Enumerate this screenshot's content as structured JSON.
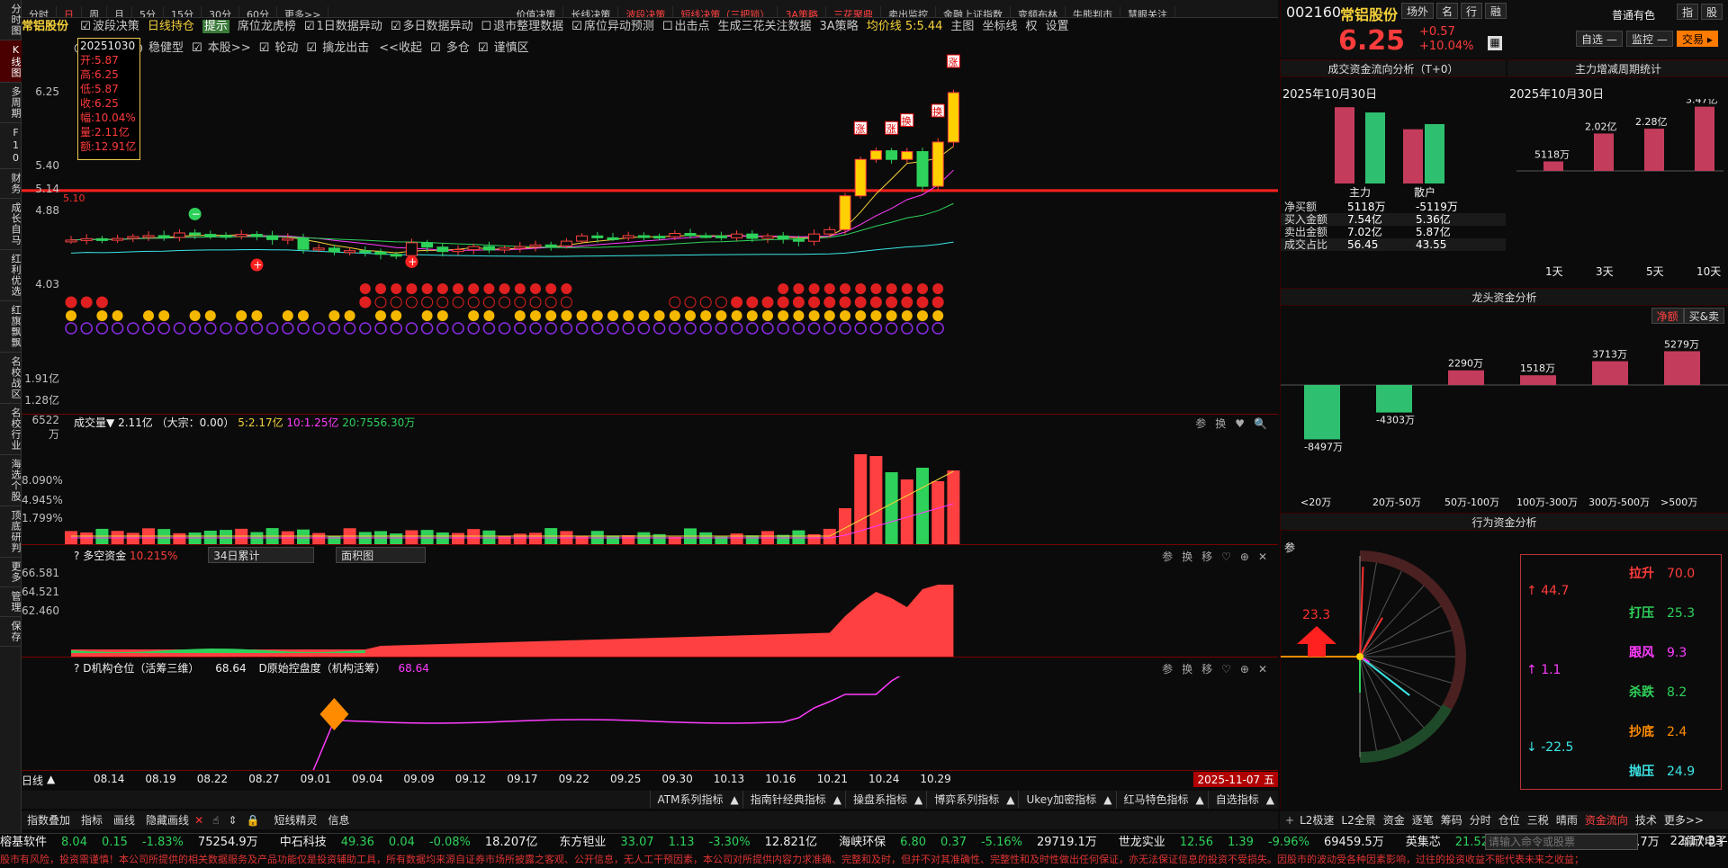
{
  "left_nav": [
    "分时图",
    "K线图",
    "多周期",
    "F10",
    "财务",
    "成长自马",
    "红利优选",
    "红旗飘飘",
    "名校战区",
    "名校行业",
    "海选个股",
    "顶底研判",
    "更多",
    "管理",
    "保存"
  ],
  "top_tabs": [
    "分时",
    "日",
    "周",
    "月",
    "5分",
    "15分",
    "30分",
    "60分",
    "更多>>"
  ],
  "strategy_tabs": [
    "价值决策",
    "长线决策",
    "波段决策",
    "短线决策（三把锁）",
    "3A策略",
    "三花聚鼎",
    "卖出监控",
    "金融上证指数",
    "变频布林",
    "牛熊判市",
    "慧眼关注"
  ],
  "chart": {
    "stock_name": "常铝股份",
    "bar1": [
      "波段决策",
      "日线持仓",
      "提示",
      "席位龙虎榜",
      "1日数据异动",
      "多日数据异动",
      "退市整理数据",
      "席位异动预测",
      "出击点",
      "生成三花关注数据",
      "3A策略",
      "均价线 5:5.44",
      "主图",
      "坐标线",
      "权",
      "设置"
    ],
    "bar2": [
      "激进型",
      "稳健型",
      "本股>>",
      "轮动",
      "擒龙出击",
      "<<收起",
      "多仓",
      "谨慎区"
    ],
    "ohlc_box": {
      "date": "20251030",
      "open": "开:5.87",
      "high": "高:6.25",
      "low": "低:5.87",
      "close": "收:6.25",
      "amp": "幅:10.04%",
      "vol": "量:2.11亿",
      "amt": "额:12.91亿"
    },
    "price_axis": [
      "6.25",
      "5.40",
      "5.14",
      "4.88",
      "4.03"
    ],
    "red_line_label": "5.10",
    "markers": [
      "涨",
      "涨",
      "换",
      "换",
      "涨",
      "涨"
    ]
  },
  "volume": {
    "title": "成交量",
    "val": "2.11亿",
    "extra": "（大宗：0.00）",
    "ma5": "5:2.17亿",
    "ma10": "10:1.25亿",
    "ma20": "20:7556.30万",
    "axis": [
      "1.91亿",
      "1.28亿",
      "6522万"
    ],
    "tools": [
      "参",
      "换",
      "♥",
      "🔍"
    ]
  },
  "duokong": {
    "title": "多空资金",
    "val": "10.215%",
    "sel1": "34日累计",
    "sel2": "面积图",
    "axis": [
      "8.090%",
      "4.945%",
      "1.799%"
    ],
    "tools": [
      "参",
      "换",
      "移",
      "♡",
      "⊕",
      "✕"
    ]
  },
  "jigou": {
    "title": "D机构仓位（活筹三维）",
    "val": "68.64",
    "title2": "D原始控盘度（机构活筹）",
    "val2": "68.64",
    "axis": [
      "66.581",
      "64.521",
      "62.460"
    ],
    "tools": [
      "参",
      "换",
      "移",
      "♡",
      "⊕",
      "✕"
    ]
  },
  "xaxis": {
    "label": "日线",
    "dates": [
      "08.14",
      "08.19",
      "08.22",
      "08.27",
      "09.01",
      "09.04",
      "09.09",
      "09.12",
      "09.17",
      "09.22",
      "09.25",
      "09.30",
      "10.13",
      "10.16",
      "10.21",
      "10.24",
      "10.29"
    ],
    "current": "2025-11-07 五"
  },
  "indicator_bar": [
    "ATM系列指标",
    "指南针经典指标",
    "操盘系指标",
    "博弈系列指标",
    "Ukey加密指标",
    "红马特色指标",
    "自选指标"
  ],
  "draw_tools": [
    "指数叠加",
    "指标",
    "画线",
    "隐藏画线",
    "短线精灵",
    "信息"
  ],
  "right_header": {
    "code": "002160",
    "name": "常铝股份",
    "tags": [
      "场外",
      "名",
      "行",
      "融"
    ],
    "price": "6.25",
    "chg": "+0.57",
    "pct": "+10.04%",
    "sector": "普通有色",
    "btns": [
      "指",
      "股"
    ],
    "btn_zx": "自选",
    "btn_jk": "监控",
    "btn_trade": "交易"
  },
  "flow": {
    "title": "成交资金流向分析（T+0）",
    "date": "2025年10月30日",
    "cats": [
      "主力",
      "散户"
    ],
    "rows": [
      [
        "净买额",
        "5118万",
        "-5119万"
      ],
      [
        "买入金额",
        "7.54亿",
        "5.36亿"
      ],
      [
        "卖出金额",
        "7.02亿",
        "5.87亿"
      ],
      [
        "成交占比",
        "56.45",
        "43.55"
      ]
    ],
    "bar_values_yi": [
      7.54,
      7.02,
      5.36,
      5.87
    ]
  },
  "period": {
    "title": "主力增减周期统计",
    "date": "2025年10月30日",
    "labels": [
      "1天",
      "3天",
      "5天",
      "10天"
    ],
    "values": [
      "5118万",
      "2.02亿",
      "2.28亿",
      "3.47亿"
    ],
    "raw": [
      0.5118,
      2.02,
      2.28,
      3.47
    ]
  },
  "leader": {
    "title": "龙头资金分析",
    "tabs": [
      "净额",
      "买&卖"
    ],
    "cats": [
      "<20万",
      "20万-50万",
      "50万-100万",
      "100万-300万",
      "300万-500万",
      ">500万"
    ],
    "values": [
      "-8497万",
      "-4303万",
      "2290万",
      "1518万",
      "3713万",
      "5279万"
    ],
    "raw": [
      -8497,
      -4303,
      2290,
      1518,
      3713,
      5279
    ]
  },
  "behavior": {
    "title": "行为资金分析",
    "tag": "参",
    "big": "23.3",
    "up": "44.7",
    "mid": "1.1",
    "down": "-22.5",
    "items": [
      [
        "拉升",
        "70.0"
      ],
      [
        "打压",
        "25.3"
      ],
      [
        "跟风",
        "9.3"
      ],
      [
        "杀跌",
        "8.2"
      ],
      [
        "抄底",
        "2.4"
      ],
      [
        "抛压",
        "24.9"
      ]
    ]
  },
  "bottom_tabs": [
    "L2极速",
    "L2全景",
    "资金",
    "逐笔",
    "筹码",
    "分时",
    "仓位",
    "三税",
    "晴雨",
    "资金流向",
    "技术",
    "更多>>"
  ],
  "ticker": [
    {
      "n": "榕基软件",
      "p": "8.04",
      "c": "0.15",
      "pc": "-1.83%",
      "v": "75254.9万"
    },
    {
      "n": "中石科技",
      "p": "49.36",
      "c": "0.04",
      "pc": "-0.08%",
      "v": "18.207亿"
    },
    {
      "n": "东方钽业",
      "p": "33.07",
      "c": "1.13",
      "pc": "-3.30%",
      "v": "12.821亿"
    },
    {
      "n": "海峡环保",
      "p": "6.80",
      "c": "0.37",
      "pc": "-5.16%",
      "v": "29719.1万"
    },
    {
      "n": "世龙实业",
      "p": "12.56",
      "c": "1.39",
      "pc": "-9.96%",
      "v": "69459.5万"
    },
    {
      "n": "英集芯",
      "p": "21.52",
      "c": "1.41",
      "pc": "-6.15%",
      "v": "35996.7万"
    },
    {
      "n": "瑜欣电子",
      "p": "",
      "c": "",
      "pc": "",
      "v": ""
    }
  ],
  "cmd_placeholder": "请输入命令或股票",
  "clock": "22:17:33",
  "disclaimer": "股市有风险，投资需谨慎！本公司所提供的相关数据服务及产品功能仅是投资辅助工具，所有数据均来源自证券市场所披露之客观、公开信息，无人工干预因素，本公司对所提供内容力求准确、完整和及时，但并不对其准确性、完整性和及时性做出任何保证，亦无法保证信息的投资不受损失。因股市的波动受各种因素影响，过往的投资收益不能代表未来之收益；"
}
